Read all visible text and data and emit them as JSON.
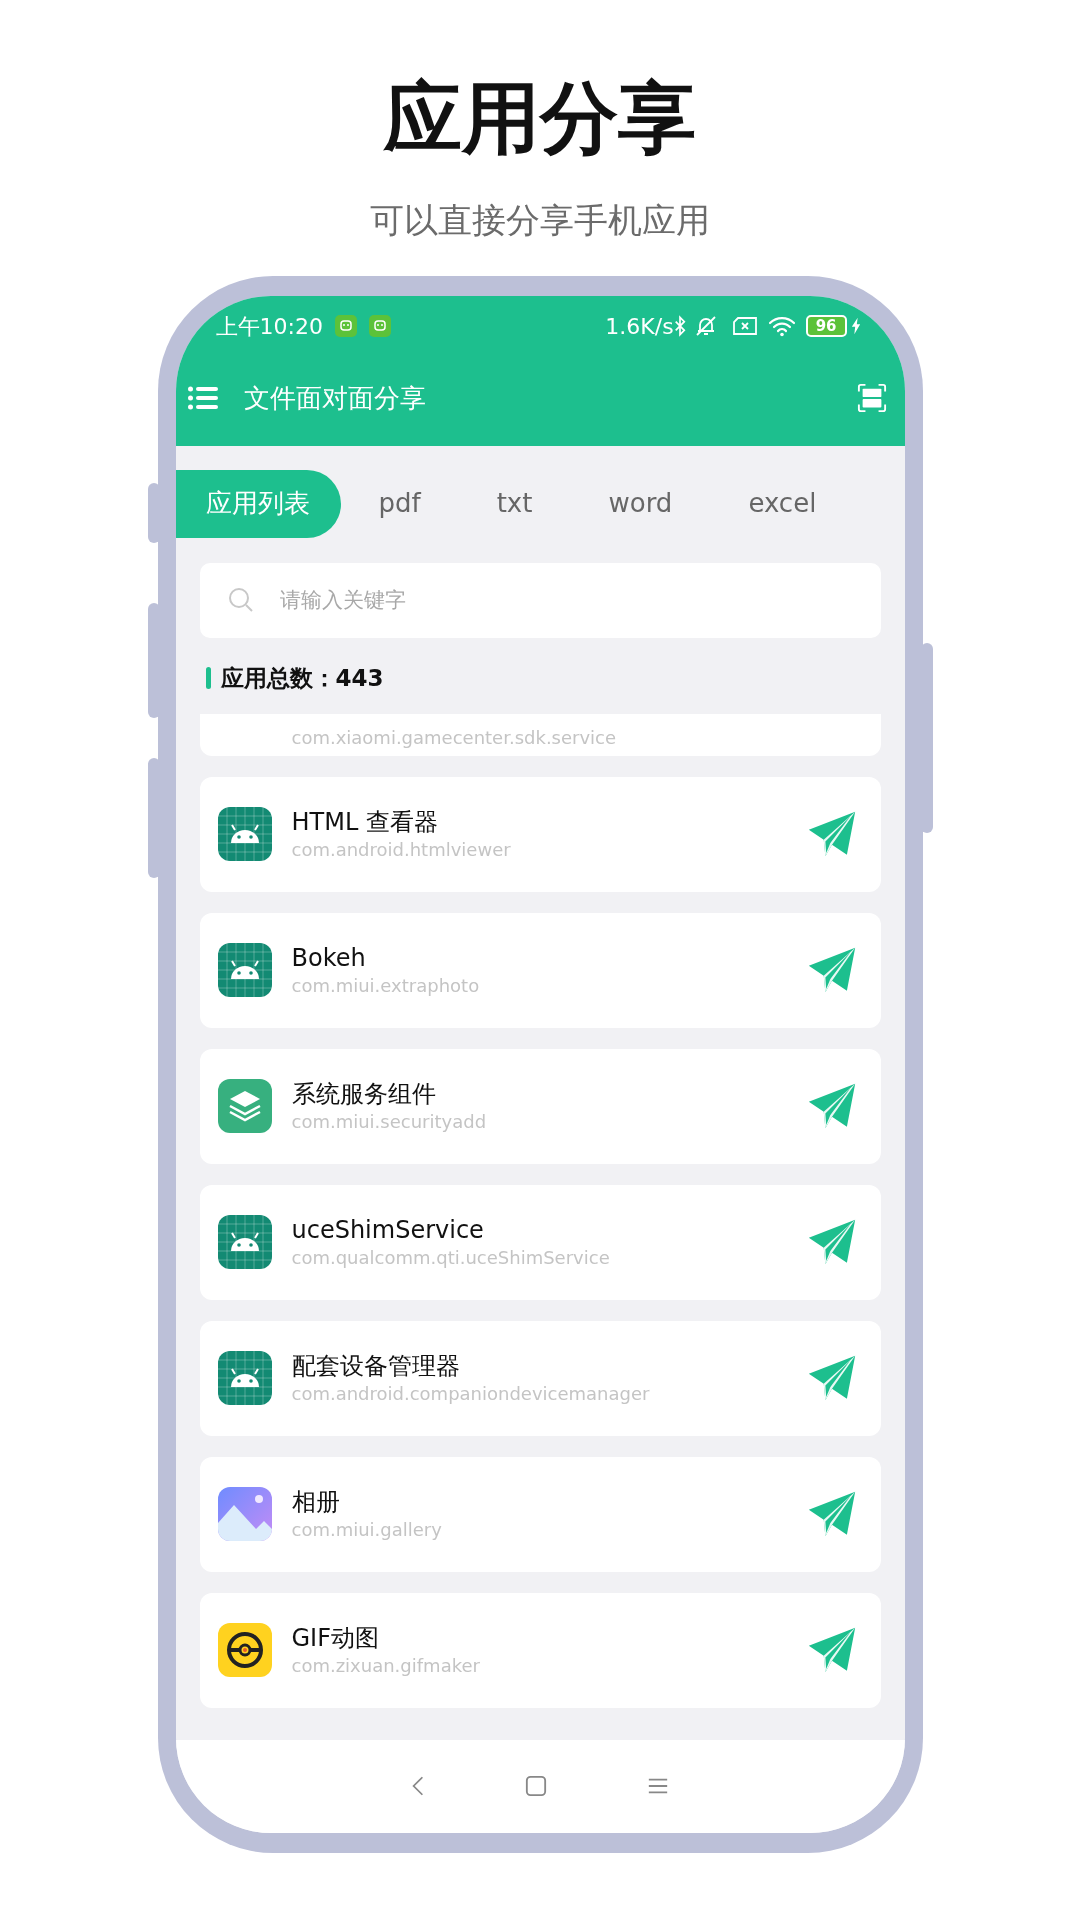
{
  "header": {
    "title": "应用分享",
    "subtitle": "可以直接分享手机应用"
  },
  "status_bar": {
    "time": "上午10:20",
    "speed": "1.6K/s",
    "battery": "96"
  },
  "app_bar": {
    "title": "文件面对面分享"
  },
  "tabs": [
    {
      "label": "应用列表",
      "selected": true
    },
    {
      "label": "pdf",
      "selected": false
    },
    {
      "label": "txt",
      "selected": false
    },
    {
      "label": "word",
      "selected": false
    },
    {
      "label": "excel",
      "selected": false
    }
  ],
  "search": {
    "placeholder": "请输入关键字"
  },
  "count_label": "应用总数：443",
  "partial_app": {
    "package": "com.xiaomi.gamecenter.sdk.service"
  },
  "apps": [
    {
      "name": "HTML 查看器",
      "package": "com.android.htmlviewer",
      "kind": "android"
    },
    {
      "name": "Bokeh",
      "package": "com.miui.extraphoto",
      "kind": "android"
    },
    {
      "name": "系统服务组件",
      "package": "com.miui.securityadd",
      "kind": "layers"
    },
    {
      "name": "uceShimService",
      "package": "com.qualcomm.qti.uceShimService",
      "kind": "android"
    },
    {
      "name": "配套设备管理器",
      "package": "com.android.companiondevicemanager",
      "kind": "android"
    },
    {
      "name": "相册",
      "package": "com.miui.gallery",
      "kind": "gallery"
    },
    {
      "name": "GIF动图",
      "package": "com.zixuan.gifmaker",
      "kind": "gif"
    }
  ]
}
